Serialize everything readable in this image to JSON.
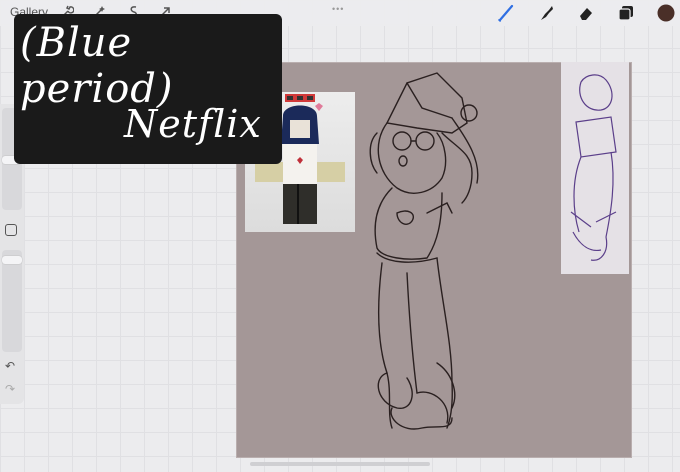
{
  "toolbar": {
    "gallery_label": "Gallery",
    "tools": [
      {
        "name": "wrench-icon"
      },
      {
        "name": "magic-wand-icon"
      },
      {
        "name": "selection-icon"
      },
      {
        "name": "transform-arrow-icon"
      }
    ],
    "right_tools": [
      {
        "name": "brush-icon",
        "color": "#2f6fe3"
      },
      {
        "name": "smudge-icon",
        "color": "#222222"
      },
      {
        "name": "eraser-icon",
        "color": "#222222"
      },
      {
        "name": "layers-icon",
        "color": "#222222"
      }
    ],
    "current_color": "#4a2f28"
  },
  "sidebar": {
    "modify_button": "square-icon",
    "undo": "undo-icon",
    "redo": "redo-icon"
  },
  "overlay": {
    "line1": "(Blue period)",
    "line2": "Netflix"
  },
  "colors": {
    "canvas_bg": "#a49797",
    "overlay_bg": "#1a1a1a",
    "brush_active": "#2f6fe3"
  }
}
